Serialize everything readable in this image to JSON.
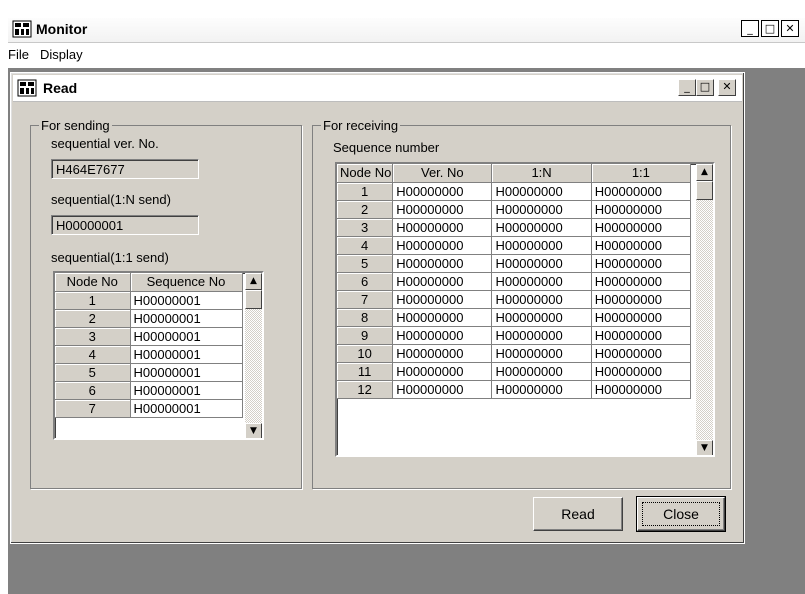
{
  "outer_window": {
    "title": "Monitor",
    "controls": {
      "minimize": "_",
      "maximize": "□",
      "close": "✕"
    },
    "menu": [
      "File",
      "Display"
    ]
  },
  "read_window": {
    "title": "Read",
    "controls": {
      "minimize": "_",
      "maximize": "□",
      "close": "✕"
    },
    "sending": {
      "group_title": "For sending",
      "ver_label": "sequential ver. No.",
      "ver_value": "H464E7677",
      "n_label": "sequential(1:N send)",
      "n_value": "H00000001",
      "one_label": "sequential(1:1 send)",
      "table": {
        "headers": [
          "Node No",
          "Sequence No"
        ],
        "rows": [
          [
            "1",
            "H00000001"
          ],
          [
            "2",
            "H00000001"
          ],
          [
            "3",
            "H00000001"
          ],
          [
            "4",
            "H00000001"
          ],
          [
            "5",
            "H00000001"
          ],
          [
            "6",
            "H00000001"
          ],
          [
            "7",
            "H00000001"
          ]
        ]
      }
    },
    "receiving": {
      "group_title": "For receiving",
      "sub_label": "Sequence number",
      "table": {
        "headers": [
          "Node No",
          "Ver. No",
          "1:N",
          "1:1"
        ],
        "rows": [
          [
            "1",
            "H00000000",
            "H00000000",
            "H00000000"
          ],
          [
            "2",
            "H00000000",
            "H00000000",
            "H00000000"
          ],
          [
            "3",
            "H00000000",
            "H00000000",
            "H00000000"
          ],
          [
            "4",
            "H00000000",
            "H00000000",
            "H00000000"
          ],
          [
            "5",
            "H00000000",
            "H00000000",
            "H00000000"
          ],
          [
            "6",
            "H00000000",
            "H00000000",
            "H00000000"
          ],
          [
            "7",
            "H00000000",
            "H00000000",
            "H00000000"
          ],
          [
            "8",
            "H00000000",
            "H00000000",
            "H00000000"
          ],
          [
            "9",
            "H00000000",
            "H00000000",
            "H00000000"
          ],
          [
            "10",
            "H00000000",
            "H00000000",
            "H00000000"
          ],
          [
            "11",
            "H00000000",
            "H00000000",
            "H00000000"
          ],
          [
            "12",
            "H00000000",
            "H00000000",
            "H00000000"
          ]
        ]
      }
    },
    "buttons": {
      "read": "Read",
      "close": "Close"
    }
  },
  "icons": {
    "app": "grid-app-icon",
    "scroll_up": "▲",
    "scroll_down": "▼"
  },
  "colors": {
    "dialog": "#d4d0c8",
    "desktop": "#808080"
  }
}
